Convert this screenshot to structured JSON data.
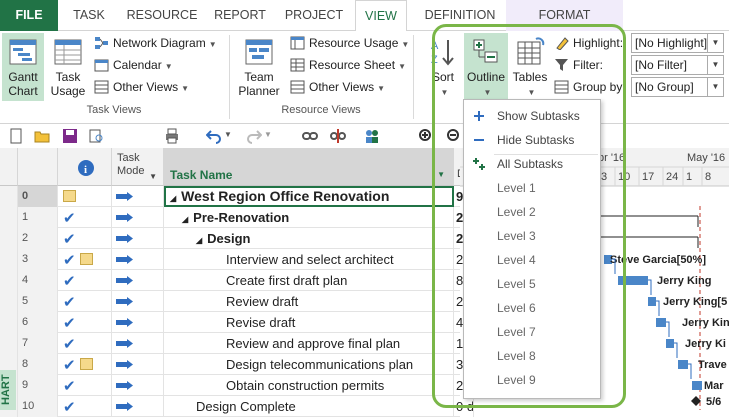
{
  "tabs": [
    "FILE",
    "TASK",
    "RESOURCE",
    "REPORT",
    "PROJECT",
    "VIEW",
    "DEFINITION",
    "FORMAT"
  ],
  "active_tab": "VIEW",
  "ribbon": {
    "task_views": {
      "label": "Task Views",
      "gantt_chart": "Gantt Chart",
      "task_usage": "Task Usage",
      "network_diagram": "Network Diagram",
      "calendar": "Calendar",
      "other_views": "Other Views"
    },
    "resource_views": {
      "label": "Resource Views",
      "team_planner": "Team Planner",
      "resource_usage": "Resource Usage",
      "resource_sheet": "Resource Sheet",
      "other_views": "Other Views"
    },
    "data": {
      "sort": "Sort",
      "outline": "Outline",
      "tables": "Tables",
      "highlight_label": "Highlight:",
      "highlight_value": "[No Highlight]",
      "filter_label": "Filter:",
      "filter_value": "[No Filter]",
      "group_label": "Group by:",
      "group_value": "[No Group]"
    }
  },
  "columns": {
    "indicators": "i",
    "task_mode": "Task Mode",
    "task_name": "Task Name",
    "duration": "D"
  },
  "rows": [
    {
      "id": "0",
      "check": false,
      "note": true,
      "name": "West Region Office Renovation",
      "level": 0,
      "summary": true,
      "dur": "9"
    },
    {
      "id": "1",
      "check": true,
      "note": false,
      "name": "Pre-Renovation",
      "level": 1,
      "summary": true,
      "dur": "2"
    },
    {
      "id": "2",
      "check": true,
      "note": false,
      "name": "Design",
      "level": 2,
      "summary": true,
      "dur": "2"
    },
    {
      "id": "3",
      "check": true,
      "note": true,
      "name": "Interview and select architect",
      "level": 3,
      "summary": false,
      "dur": "2"
    },
    {
      "id": "4",
      "check": true,
      "note": false,
      "name": "Create first draft plan",
      "level": 3,
      "summary": false,
      "dur": "8"
    },
    {
      "id": "5",
      "check": true,
      "note": false,
      "name": "Review draft",
      "level": 3,
      "summary": false,
      "dur": "2"
    },
    {
      "id": "6",
      "check": true,
      "note": false,
      "name": "Revise draft",
      "level": 3,
      "summary": false,
      "dur": "4"
    },
    {
      "id": "7",
      "check": true,
      "note": false,
      "name": "Review and approve final plan",
      "level": 3,
      "summary": false,
      "dur": "1"
    },
    {
      "id": "8",
      "check": true,
      "note": true,
      "name": "Design telecommunications plan",
      "level": 3,
      "summary": false,
      "dur": "3"
    },
    {
      "id": "9",
      "check": true,
      "note": false,
      "name": "Obtain construction permits",
      "level": 3,
      "summary": false,
      "dur": "2"
    },
    {
      "id": "10",
      "check": true,
      "note": false,
      "name": "Design Complete",
      "level": 2,
      "summary": false,
      "dur": "0 d"
    }
  ],
  "timescale": {
    "months": [
      "pr '16",
      "May '16"
    ],
    "days": [
      "3",
      "10",
      "17",
      "24",
      "1",
      "8"
    ]
  },
  "gantt_labels": [
    "Steve Garcia[50%]",
    "Jerry King",
    "Jerry King[5",
    "Jerry Kin",
    "Jerry Ki",
    "Trave",
    "Mar",
    "5/6"
  ],
  "outline_menu": {
    "show_subtasks": "Show Subtasks",
    "hide_subtasks": "Hide Subtasks",
    "all_subtasks": "All Subtasks",
    "levels": [
      "Level 1",
      "Level 2",
      "Level 3",
      "Level 4",
      "Level 5",
      "Level 6",
      "Level 7",
      "Level 8",
      "Level 9"
    ]
  },
  "side_label": "HART",
  "colors": {
    "accent": "#217346",
    "highlight_border": "#7ab648",
    "bar": "#4a86c8",
    "selected": "#c5e3cf"
  }
}
